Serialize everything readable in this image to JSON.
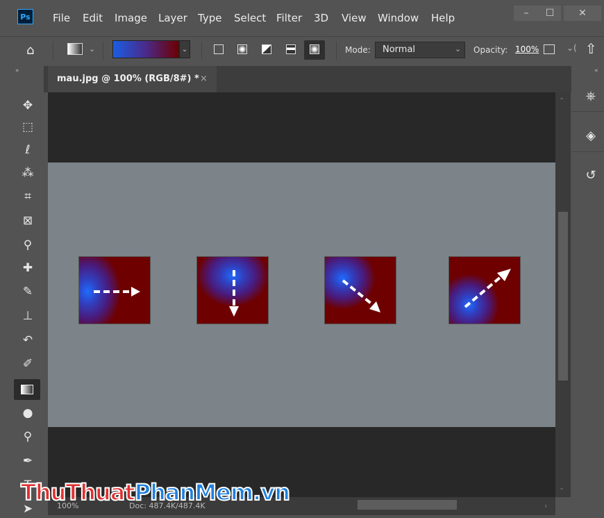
{
  "app": {
    "logo_text": "Ps"
  },
  "menu": [
    "File",
    "Edit",
    "Image",
    "Layer",
    "Type",
    "Select",
    "Filter",
    "3D",
    "View",
    "Window",
    "Help"
  ],
  "window_controls": {
    "minimize": "–",
    "maximize": "☐",
    "close": "✕"
  },
  "options_bar": {
    "mode_label": "Mode:",
    "mode_value": "Normal",
    "opacity_label": "Opacity:",
    "opacity_value": "100%"
  },
  "document_tab": {
    "title": "mau.jpg @ 100% (RGB/8#) *",
    "close": "×"
  },
  "status": {
    "zoom": "100%",
    "doc": "Doc: 487.4K/487.4K"
  },
  "watermark": {
    "part1": "ThuThuat",
    "part2": "PhanMem",
    "part3": ".vn"
  },
  "colors": {
    "accent": "#31a8ff",
    "canvas": "#7c8389",
    "gradient_start": "#1f6cff",
    "gradient_end": "#6e0000"
  },
  "gradient_samples": [
    {
      "direction": "right"
    },
    {
      "direction": "down"
    },
    {
      "direction": "down-right"
    },
    {
      "direction": "up-right"
    }
  ]
}
